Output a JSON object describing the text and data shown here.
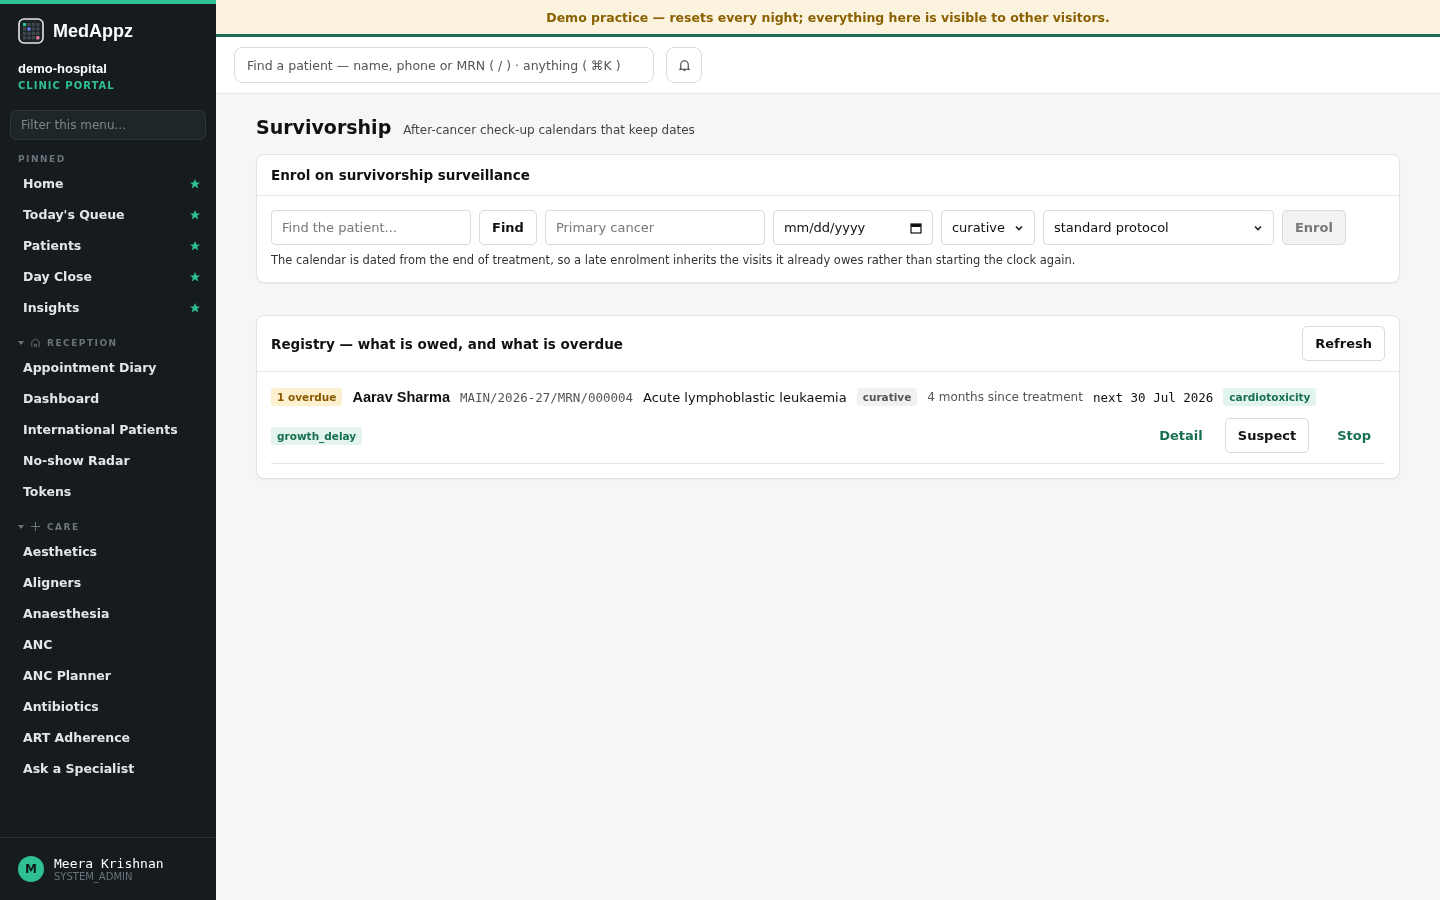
{
  "banner": {
    "text": "Demo practice — resets every night; everything here is visible to other visitors."
  },
  "topbar": {
    "search": {
      "placeholder": "Find a patient — name, phone or MRN ( / ) · anything ( ⌘K )"
    }
  },
  "sidebar": {
    "brand": "MedAppz",
    "org": "demo-hospital",
    "portal": "CLINIC PORTAL",
    "filter": {
      "placeholder": "Filter this menu..."
    },
    "pinned_label": "PINNED",
    "pinned": [
      {
        "label": "Home",
        "starred": true
      },
      {
        "label": "Today's Queue",
        "starred": true
      },
      {
        "label": "Patients",
        "starred": true
      },
      {
        "label": "Day Close",
        "starred": true
      },
      {
        "label": "Insights",
        "starred": true
      }
    ],
    "sections": [
      {
        "label": "RECEPTION",
        "kind": "house",
        "expanded": true,
        "items": [
          "Appointment Diary",
          "Dashboard",
          "International Patients",
          "No-show Radar",
          "Tokens"
        ]
      },
      {
        "label": "CARE",
        "kind": "plus",
        "expanded": true,
        "items": [
          "Aesthetics",
          "Aligners",
          "Anaesthesia",
          "ANC",
          "ANC Planner",
          "Antibiotics",
          "ART Adherence",
          "Ask a Specialist"
        ]
      }
    ],
    "user": {
      "initial": "M",
      "name": "Meera Krishnan",
      "role": "SYSTEM_ADMIN"
    }
  },
  "page": {
    "title": "Survivorship",
    "subtitle": "After-cancer check-up calendars that keep dates"
  },
  "enrol": {
    "title": "Enrol on survivorship surveillance",
    "patient": {
      "placeholder": "Find the patient..."
    },
    "find": "Find",
    "cancer": {
      "placeholder": "Primary cancer"
    },
    "date": {
      "value": "mm/dd/yyyy"
    },
    "intent": {
      "value": "curative"
    },
    "protocol": {
      "value": "standard protocol"
    },
    "enrol_button": {
      "label": "Enrol",
      "disabled": true
    },
    "note": "The calendar is dated from the end of treatment, so a late enrolment inherits the visits it already owes rather than starting the clock again."
  },
  "registry": {
    "title": "Registry — what is owed, and what is overdue",
    "refresh": "Refresh",
    "rows": [
      {
        "overdue": "1 overdue",
        "name": "Aarav Sharma",
        "mrn": "MAIN/2026-27/MRN/000004",
        "cancer": "Acute lymphoblastic leukaemia",
        "intent": "curative",
        "since": "4 months since treatment",
        "next": "next 30 Jul 2026",
        "tags": [
          "cardiotoxicity",
          "growth_delay"
        ],
        "actions": [
          {
            "label": "Detail",
            "kind": "link"
          },
          {
            "label": "Suspect",
            "kind": "button"
          },
          {
            "label": "Stop",
            "kind": "link"
          }
        ]
      }
    ]
  }
}
